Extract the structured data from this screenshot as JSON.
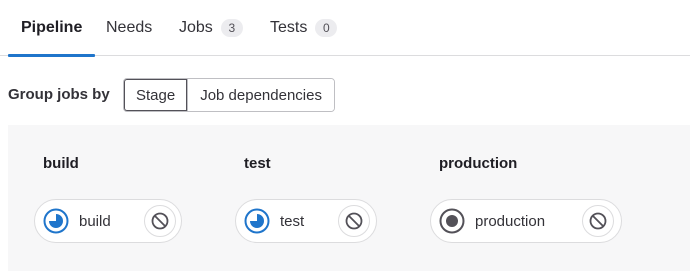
{
  "tabs": [
    {
      "label": "Pipeline",
      "active": true
    },
    {
      "label": "Needs"
    },
    {
      "label": "Jobs",
      "badge": "3"
    },
    {
      "label": "Tests",
      "badge": "0"
    }
  ],
  "group_jobs": {
    "label": "Group jobs by",
    "options": [
      "Stage",
      "Job dependencies"
    ],
    "selected": "Stage"
  },
  "stages": [
    {
      "title": "build",
      "jobs": [
        {
          "name": "build",
          "status_icon": "running-icon",
          "action_icon": "cancel-icon"
        }
      ]
    },
    {
      "title": "test",
      "jobs": [
        {
          "name": "test",
          "status_icon": "running-icon",
          "action_icon": "cancel-icon"
        }
      ]
    },
    {
      "title": "production",
      "jobs": [
        {
          "name": "production",
          "status_icon": "pending-icon",
          "action_icon": "cancel-icon"
        }
      ]
    }
  ],
  "colors": {
    "accent": "#1f75cb",
    "running": "#1f75cb",
    "pending": "#535158",
    "area_bg": "#f7f7f8",
    "border": "#dcdcde"
  }
}
